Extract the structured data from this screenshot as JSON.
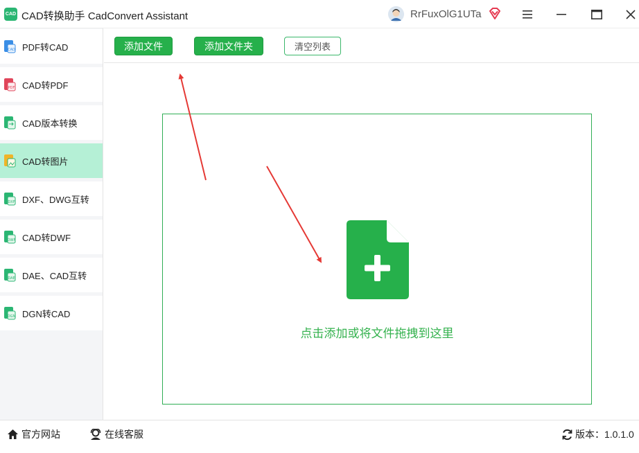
{
  "window": {
    "title": "CAD转换助手 CadConvert Assistant",
    "logo_text": "CAD",
    "username": "RrFuxOlG1UTa"
  },
  "sidebar": {
    "items": [
      {
        "label": "PDF转CAD"
      },
      {
        "label": "CAD转PDF"
      },
      {
        "label": "CAD版本转换"
      },
      {
        "label": "CAD转图片",
        "active": true
      },
      {
        "label": "DXF、DWG互转"
      },
      {
        "label": "CAD转DWF"
      },
      {
        "label": "DAE、CAD互转"
      },
      {
        "label": "DGN转CAD"
      }
    ]
  },
  "toolbar": {
    "add_file_label": "添加文件",
    "add_folder_label": "添加文件夹",
    "clear_list_label": "清空列表"
  },
  "dropzone": {
    "hint": "点击添加或将文件拖拽到这里"
  },
  "footer": {
    "website_label": "官方网站",
    "support_label": "在线客服",
    "version_label": "版本：1.0.1.0"
  },
  "colors": {
    "accent_green": "#26b04b",
    "sidebar_active": "#b5f0d6",
    "annotation_red": "#e53935"
  }
}
